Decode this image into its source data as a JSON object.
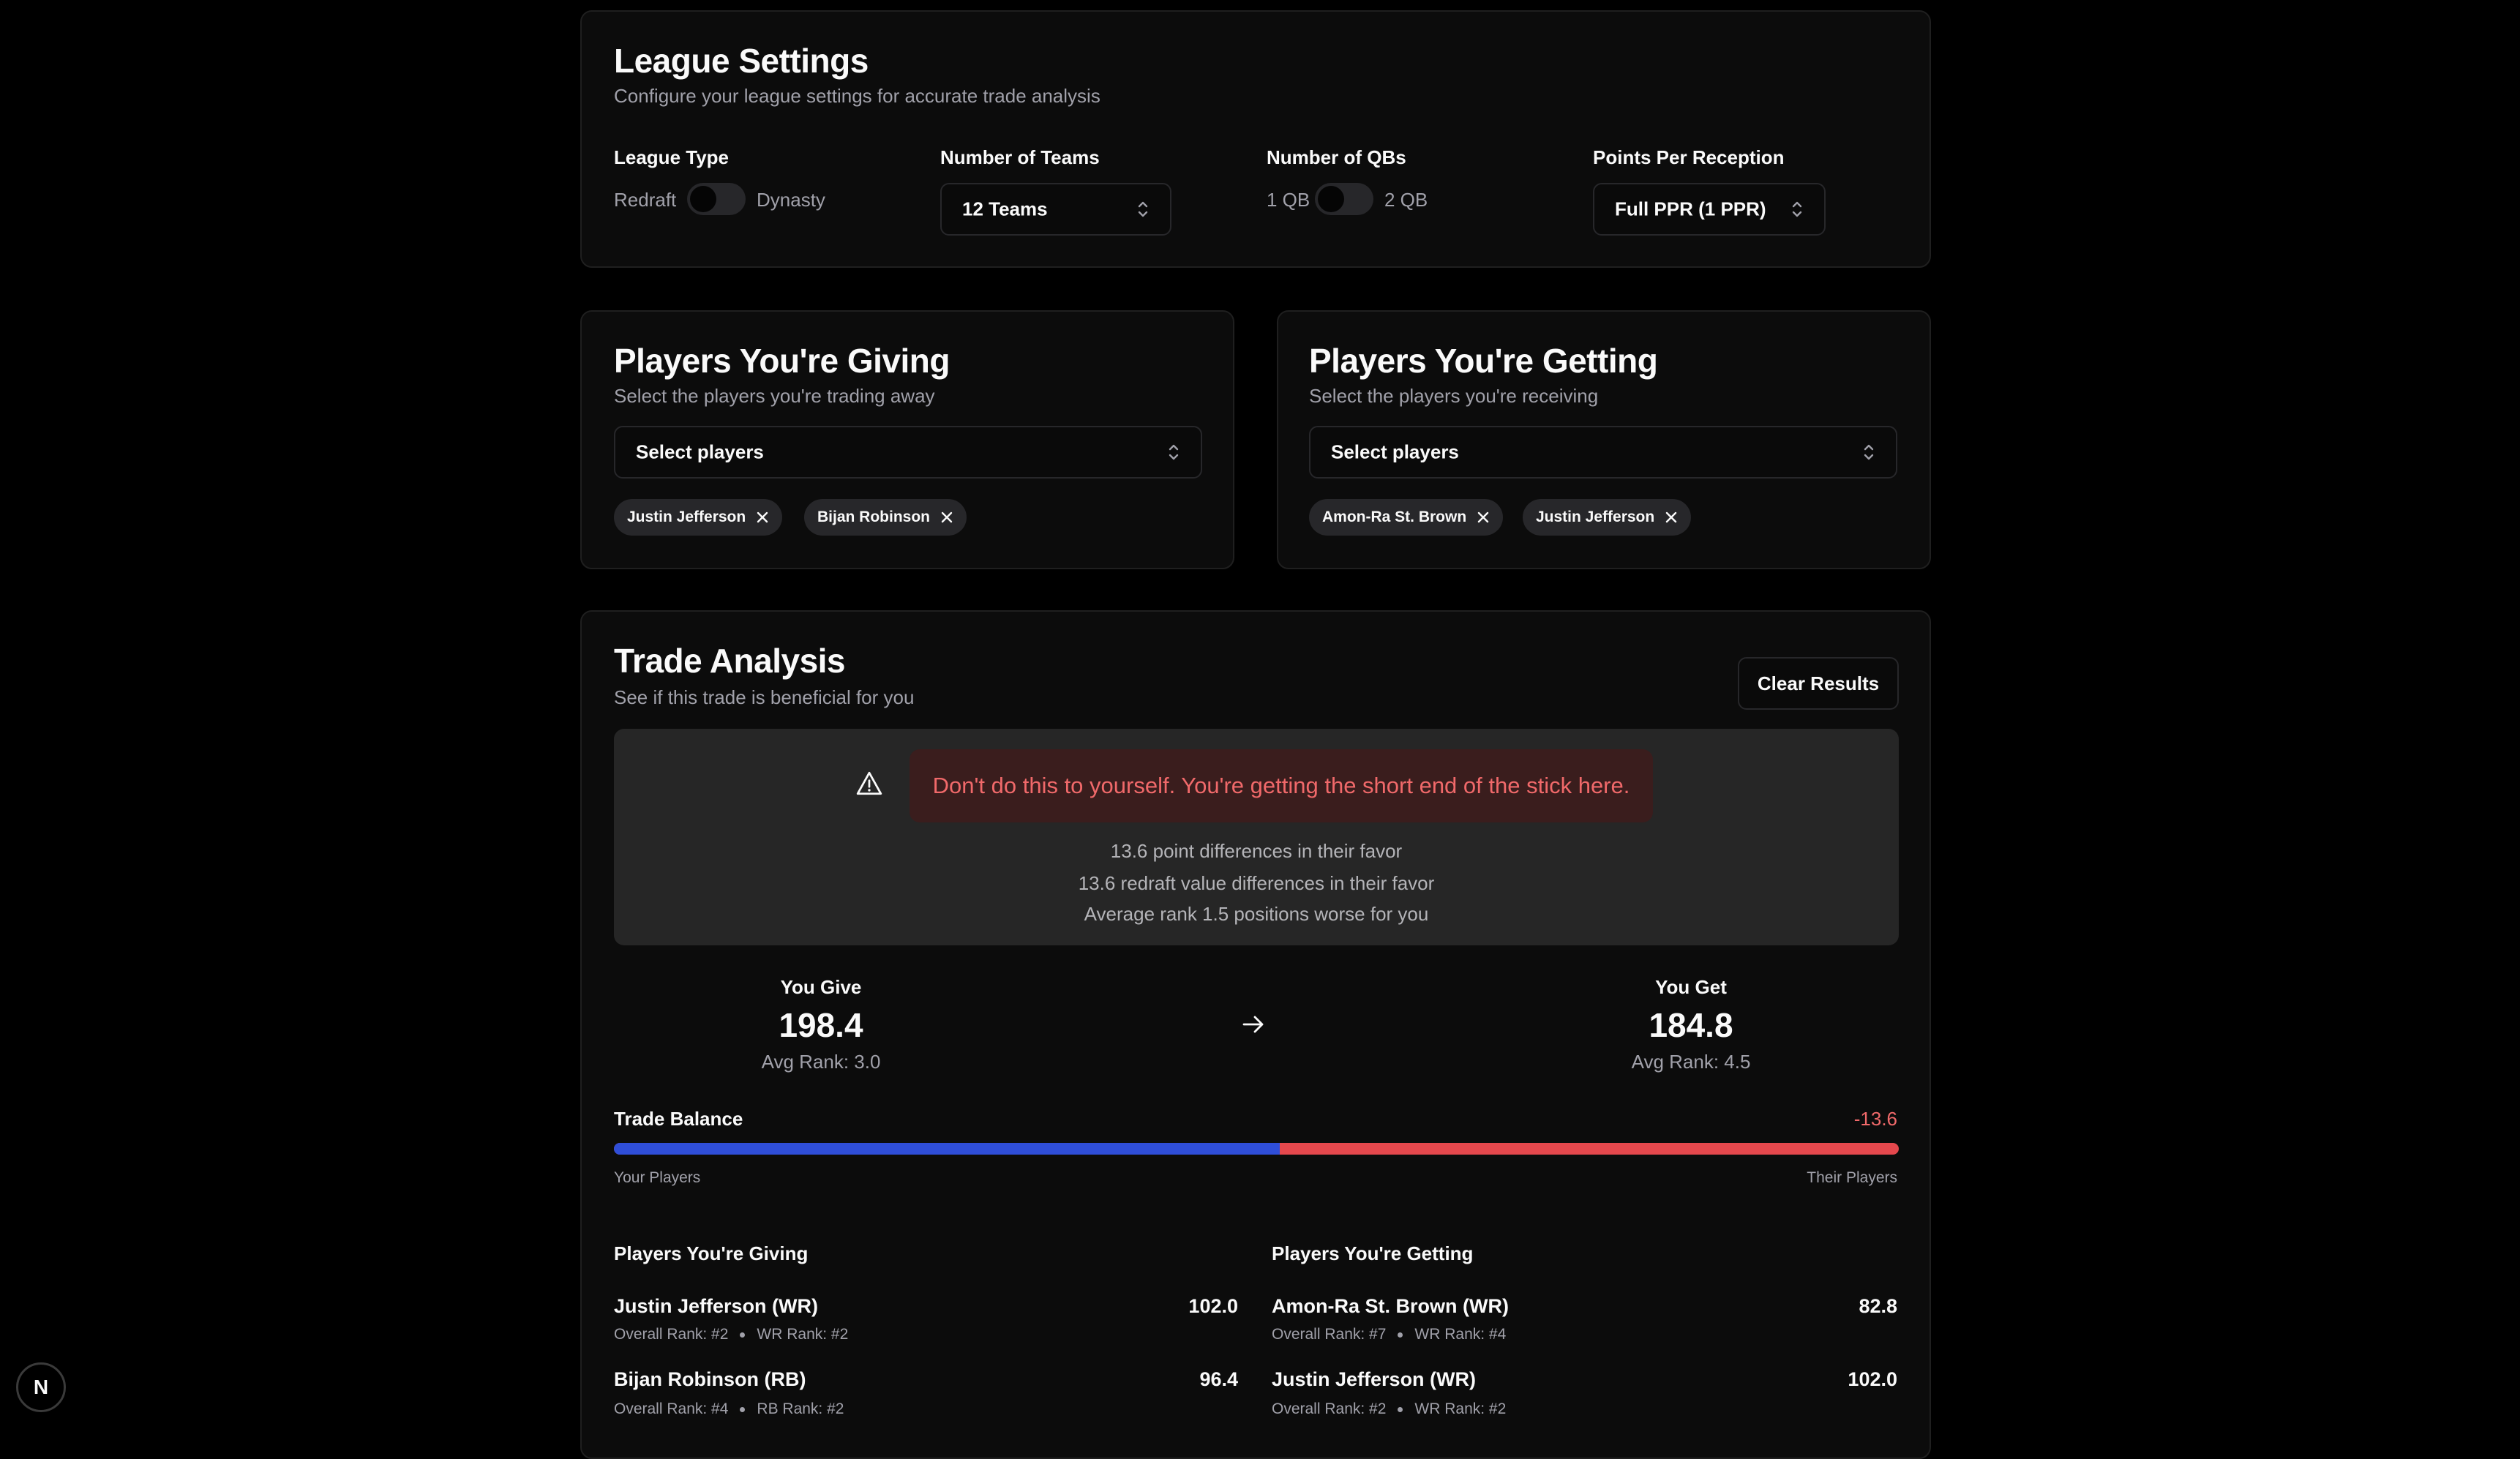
{
  "league_settings": {
    "title": "League Settings",
    "subtitle": "Configure your league settings for accurate trade analysis",
    "league_type": {
      "label": "League Type",
      "off_label": "Redraft",
      "on_label": "Dynasty",
      "checked": false
    },
    "teams": {
      "label": "Number of Teams",
      "value": "12 Teams"
    },
    "qbs": {
      "label": "Number of QBs",
      "off_label": "1 QB",
      "on_label": "2 QB",
      "checked": false
    },
    "ppr": {
      "label": "Points Per Reception",
      "value": "Full PPR (1 PPR)"
    }
  },
  "giving": {
    "title": "Players You're Giving",
    "subtitle": "Select the players you're trading away",
    "placeholder": "Select players",
    "chips": [
      "Justin Jefferson",
      "Bijan Robinson"
    ]
  },
  "getting": {
    "title": "Players You're Getting",
    "subtitle": "Select the players you're receiving",
    "placeholder": "Select players",
    "chips": [
      "Amon-Ra St. Brown",
      "Justin Jefferson"
    ]
  },
  "analysis": {
    "title": "Trade Analysis",
    "subtitle": "See if this trade is beneficial for you",
    "clear_label": "Clear Results",
    "verdict": "Don't do this to yourself. You're getting the short end of the stick here.",
    "details": [
      "13.6 point differences in their favor",
      "13.6 redraft value differences in their favor",
      "Average rank 1.5 positions worse for you"
    ],
    "give": {
      "label": "You Give",
      "value": "198.4",
      "avg_rank": "Avg Rank: 3.0"
    },
    "get": {
      "label": "You Get",
      "value": "184.8",
      "avg_rank": "Avg Rank: 4.5"
    },
    "balance": {
      "label": "Trade Balance",
      "value": "-13.6",
      "your_share": 0.518,
      "left_label": "Your Players",
      "right_label": "Their Players"
    },
    "giving_list": {
      "title": "Players You're Giving",
      "rows": [
        {
          "name": "Justin Jefferson (WR)",
          "overall": "Overall Rank: #2",
          "pos": "WR Rank: #2",
          "value": "102.0"
        },
        {
          "name": "Bijan Robinson (RB)",
          "overall": "Overall Rank: #4",
          "pos": "RB Rank: #2",
          "value": "96.4"
        }
      ]
    },
    "getting_list": {
      "title": "Players You're Getting",
      "rows": [
        {
          "name": "Amon-Ra St. Brown (WR)",
          "overall": "Overall Rank: #7",
          "pos": "WR Rank: #4",
          "value": "82.8"
        },
        {
          "name": "Justin Jefferson (WR)",
          "overall": "Overall Rank: #2",
          "pos": "WR Rank: #2",
          "value": "102.0"
        }
      ]
    }
  },
  "colors": {
    "your_side": "#2f4ed8",
    "their_side": "#e5484d",
    "danger_text": "#f0696a"
  },
  "nextjs_badge": "N"
}
